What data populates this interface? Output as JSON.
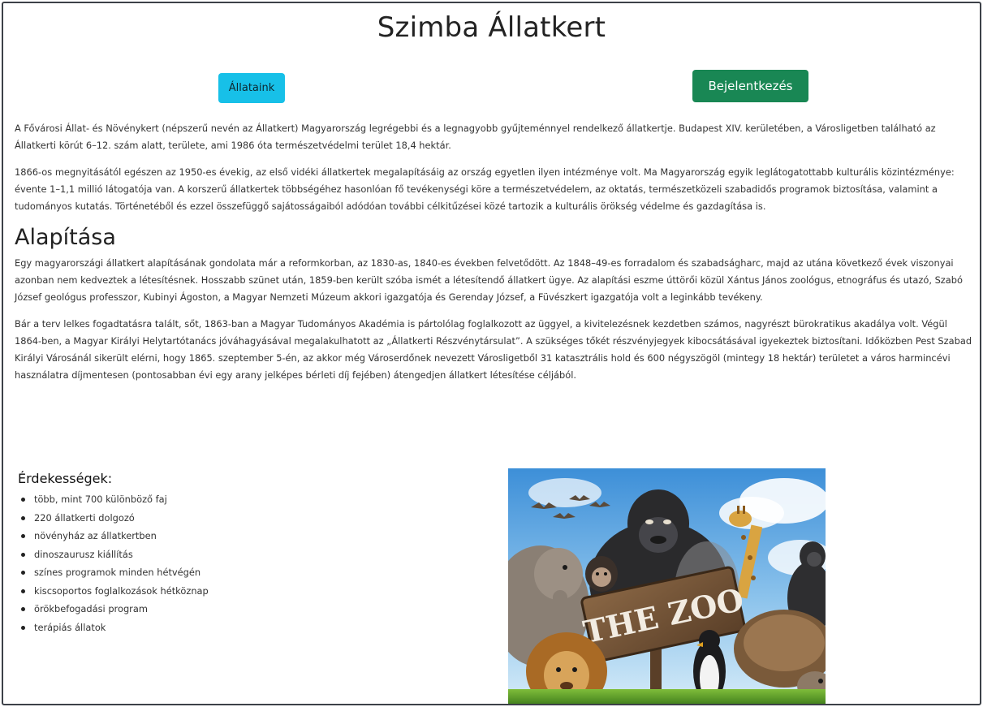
{
  "header": {
    "title": "Szimba Állatkert"
  },
  "nav": {
    "animals_label": "Állataink",
    "login_label": "Bejelentkezés"
  },
  "intro": {
    "p1": "A Fővárosi Állat- és Növénykert (népszerű nevén az Állatkert) Magyarország legrégebbi és a legnagyobb gyűjteménnyel rendelkező állatkertje. Budapest XIV. kerületében, a Városligetben található az Állatkerti körút 6–12. szám alatt, területe, ami 1986 óta természetvédelmi terület 18,4 hektár.",
    "p2": "1866-os megnyitásától egészen az 1950-es évekig, az első vidéki állatkertek megalapításáig az ország egyetlen ilyen intézménye volt. Ma Magyarország egyik leglátogatottabb kulturális közintézménye: évente 1–1,1 millió látogatója van. A korszerű állatkertek többségéhez hasonlóan fő tevékenységi köre a természetvédelem, az oktatás, természetközeli szabadidős programok biztosítása, valamint a tudományos kutatás. Történetéből és ezzel összefüggő sajátosságaiból adódóan további célkitűzései közé tartozik a kulturális örökség védelme és gazdagítása is."
  },
  "founding": {
    "heading": "Alapítása",
    "p1": "Egy magyarországi állatkert alapításának gondolata már a reformkorban, az 1830-as, 1840-es években felvetődött. Az 1848–49-es forradalom és szabadságharc, majd az utána következő évek viszonyai azonban nem kedveztek a létesítésnek. Hosszabb szünet után, 1859-ben került szóba ismét a létesítendő állatkert ügye. Az alapítási eszme úttörői közül Xántus János zoológus, etnográfus és utazó, Szabó József geológus professzor, Kubinyi Ágoston, a Magyar Nemzeti Múzeum akkori igazgatója és Gerenday József, a Füvészkert igazgatója volt a leginkább tevékeny.",
    "p2": "Bár a terv lelkes fogadtatásra talált, sőt, 1863-ban a Magyar Tudományos Akadémia is pártolólag foglalkozott az üggyel, a kivitelezésnek kezdetben számos, nagyrészt bürokratikus akadálya volt. Végül 1864-ben, a Magyar Királyi Helytartótanács jóváhagyásával megalakulhatott az „Állatkerti Részvénytársulat”. A szükséges tőkét részvényjegyek kibocsátásával igyekeztek biztosítani. Időközben Pest Szabad Királyi Városánál sikerült elérni, hogy 1865. szeptember 5-én, az akkor még Városerdőnek nevezett Városligetből 31 katasztrális hold és 600 négyszögöl (mintegy 18 hektár) területet a város harmincévi használatra díjmentesen (pontosabban évi egy arany jelképes bérleti díj fejében) átengedjen állatkert létesítése céljából."
  },
  "interests": {
    "title": "Érdekességek:",
    "items": [
      "több, mint 700 különböző faj",
      "220 állatkerti dolgozó",
      "növényház az állatkertben",
      "dinoszaurusz kiállítás",
      "színes programok minden hétvégén",
      "kiscsoportos foglalkozások hétköznap",
      "örökbefogadási program",
      "terápiás állatok"
    ]
  },
  "image": {
    "sign_text": "THE ZOO"
  },
  "colors": {
    "animals_button": "#17c0e8",
    "login_button": "#198754",
    "text": "#333333",
    "frame_border": "#3d4148"
  }
}
